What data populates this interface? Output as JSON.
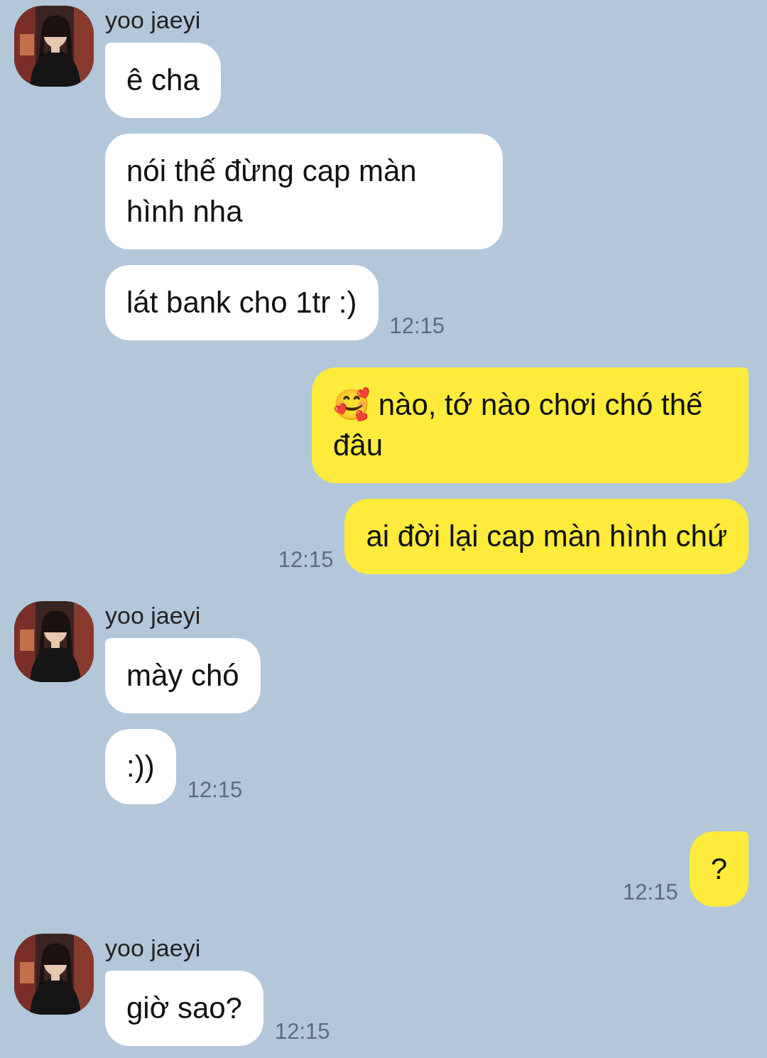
{
  "groups": [
    {
      "kind": "incoming",
      "sender": "yoo jaeyi",
      "avatar": {
        "kind": "picture"
      },
      "messages": [
        "ê cha",
        "nói thế đừng cap màn hình nha",
        "lát bank cho 1tr :)"
      ],
      "time": "12:15"
    },
    {
      "kind": "outgoing",
      "messages": [
        "🥰 nào, tớ nào chơi chó thế đâu",
        "ai đời lại cap màn hình chứ"
      ],
      "time": "12:15"
    },
    {
      "kind": "incoming",
      "sender": "yoo jaeyi",
      "avatar": {
        "kind": "picture"
      },
      "messages": [
        "mày chó",
        ":))"
      ],
      "time": "12:15"
    },
    {
      "kind": "outgoing",
      "messages": [
        "?"
      ],
      "time": "12:15"
    },
    {
      "kind": "incoming",
      "sender": "yoo jaeyi",
      "avatar": {
        "kind": "picture"
      },
      "messages": [
        "giờ sao?"
      ],
      "time": "12:15"
    }
  ]
}
